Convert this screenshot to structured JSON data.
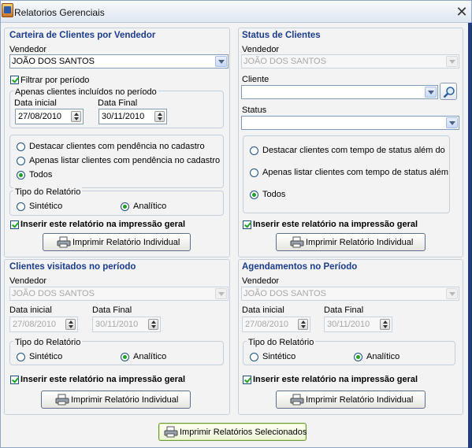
{
  "window": {
    "title": "Relatorios Gerenciais"
  },
  "carteira": {
    "title": "Carteira de Clientes por Vendedor",
    "vendedor_label": "Vendedor",
    "vendedor_value": "JOÃO DOS SANTOS",
    "filtrar_label": "Filtrar por período",
    "periodo_title": "Apenas clientes incluídos no período",
    "data_inicial_label": "Data inicial",
    "data_inicial_value": "27/08/2010",
    "data_final_label": "Data Final",
    "data_final_value": "30/11/2010",
    "opt1": "Destacar clientes com pendência no cadastro",
    "opt2": "Apenas listar clientes com pendência no cadastro",
    "opt3": "Todos",
    "tipo_title": "Tipo do Relatório",
    "sintetico": "Sintético",
    "analitico": "Analítico",
    "inserir": "Inserir este relatório na impressão geral",
    "imprimir": "Imprimir Relatório Individual"
  },
  "status": {
    "title": "Status de Clientes",
    "vendedor_label": "Vendedor",
    "vendedor_value": "JOÃO DOS SANTOS",
    "cliente_label": "Cliente",
    "cliente_value": "",
    "status_label": "Status",
    "status_value": "",
    "opt1": "Destacar clientes com tempo de status além do",
    "opt2": "Apenas listar clientes com tempo de status além",
    "opt3": "Todos",
    "inserir": "Inserir este relatório na impressão geral",
    "imprimir": "Imprimir Relatório Individual"
  },
  "visitados": {
    "title": "Clientes visitados no período",
    "vendedor_label": "Vendedor",
    "vendedor_value": "JOÃO DOS SANTOS",
    "data_inicial_label": "Data inicial",
    "data_inicial_value": "27/08/2010",
    "data_final_label": "Data Final",
    "data_final_value": "30/11/2010",
    "tipo_title": "Tipo do Relatório",
    "sintetico": "Sintético",
    "analitico": "Analítico",
    "inserir": "Inserir este relatório na impressão geral",
    "imprimir": "Imprimir Relatório Individual"
  },
  "agendamentos": {
    "title": "Agendamentos no Período",
    "vendedor_label": "Vendedor",
    "vendedor_value": "JOÃO DOS SANTOS",
    "data_inicial_label": "Data inicial",
    "data_inicial_value": "27/08/2010",
    "data_final_label": "Data Final",
    "data_final_value": "30/11/2010",
    "tipo_title": "Tipo do Relatório",
    "sintetico": "Sintético",
    "analitico": "Analítico",
    "inserir": "Inserir este relatório na impressão geral",
    "imprimir": "Imprimir Relatório Individual"
  },
  "footer": {
    "imprimir_selecionados": "Imprimir Relatórios Selecionados"
  },
  "icons": {
    "app": "app-icon",
    "close": "close-icon",
    "printer": "printer-icon",
    "search": "search-icon"
  }
}
